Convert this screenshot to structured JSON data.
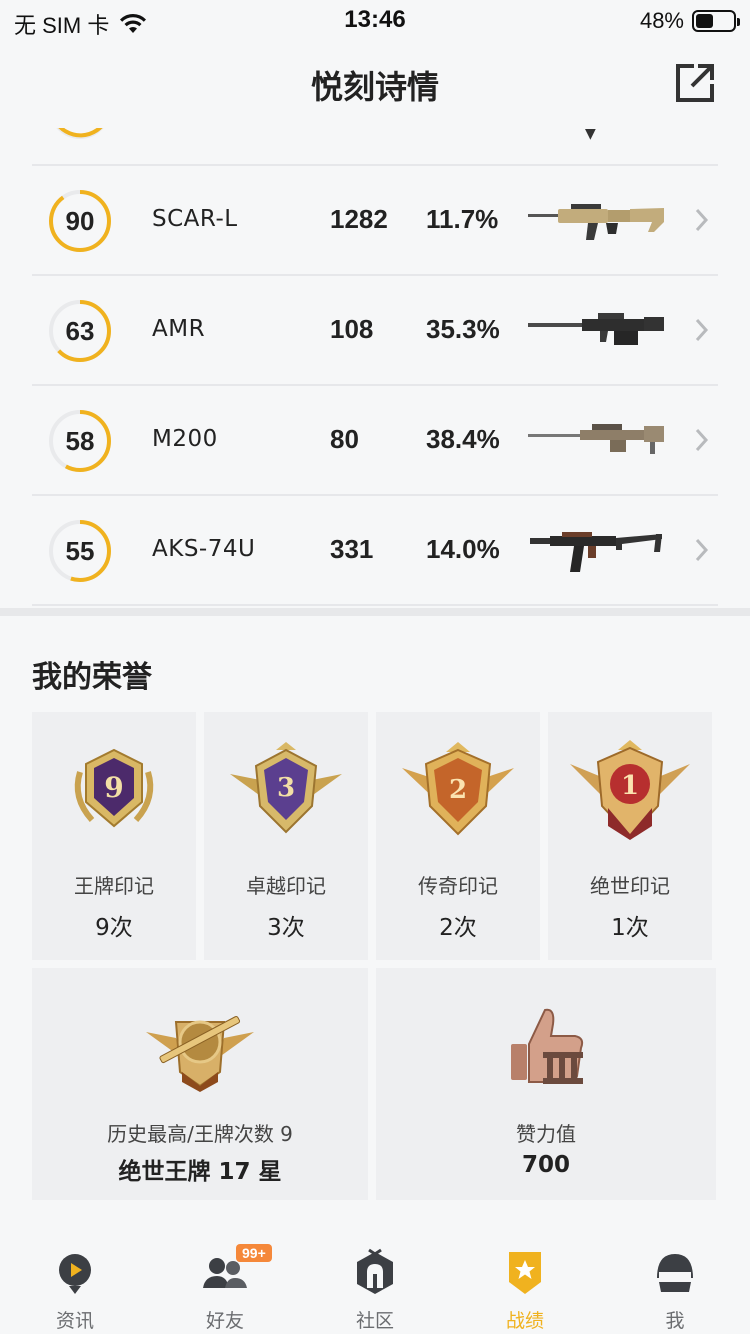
{
  "status_bar": {
    "carrier": "无 SIM 卡",
    "time": "13:46",
    "battery": "48%",
    "battery_level": 0.48
  },
  "header": {
    "title": "悦刻诗情",
    "share_icon": "share-external-icon"
  },
  "weapons": [
    {
      "score": "90",
      "score_level": 0.9,
      "name": "SCAR-L",
      "kills": "1282",
      "rate": "11.7%",
      "icon": "scar-l-rifle-icon"
    },
    {
      "score": "63",
      "score_level": 0.63,
      "name": "AMR",
      "kills": "108",
      "rate": "35.3%",
      "icon": "amr-sniper-icon"
    },
    {
      "score": "58",
      "score_level": 0.58,
      "name": "M200",
      "kills": "80",
      "rate": "38.4%",
      "icon": "m200-sniper-icon"
    },
    {
      "score": "55",
      "score_level": 0.55,
      "name": "AKS-74U",
      "kills": "331",
      "rate": "14.0%",
      "icon": "aks-74u-rifle-icon"
    }
  ],
  "honors": {
    "title": "我的荣誉",
    "marks": [
      {
        "label": "王牌印记",
        "count": "9次",
        "badge_number": "9",
        "icon": "ace-mark-badge-icon"
      },
      {
        "label": "卓越印记",
        "count": "3次",
        "badge_number": "3",
        "icon": "excellence-mark-badge-icon"
      },
      {
        "label": "传奇印记",
        "count": "2次",
        "badge_number": "2",
        "icon": "legend-mark-badge-icon"
      },
      {
        "label": "绝世印记",
        "count": "1次",
        "badge_number": "1",
        "icon": "peerless-mark-badge-icon"
      }
    ],
    "highest": {
      "label": "历史最高/王牌次数 9",
      "value": "绝世王牌 17 星",
      "icon": "highest-rank-badge-icon"
    },
    "likes": {
      "label": "赞力值",
      "value": "700",
      "icon": "thumbs-up-trophy-icon"
    }
  },
  "nav": {
    "items": [
      {
        "label": "资讯",
        "icon": "news-play-icon"
      },
      {
        "label": "好友",
        "icon": "friends-icon",
        "badge": "99+"
      },
      {
        "label": "社区",
        "icon": "community-icon"
      },
      {
        "label": "战绩",
        "icon": "record-badge-icon",
        "active": true
      },
      {
        "label": "我",
        "icon": "profile-helmet-icon"
      }
    ]
  },
  "colors": {
    "accent": "#f0b21f",
    "ring_track": "#e9eaec",
    "badge_orange": "#f5883a"
  }
}
